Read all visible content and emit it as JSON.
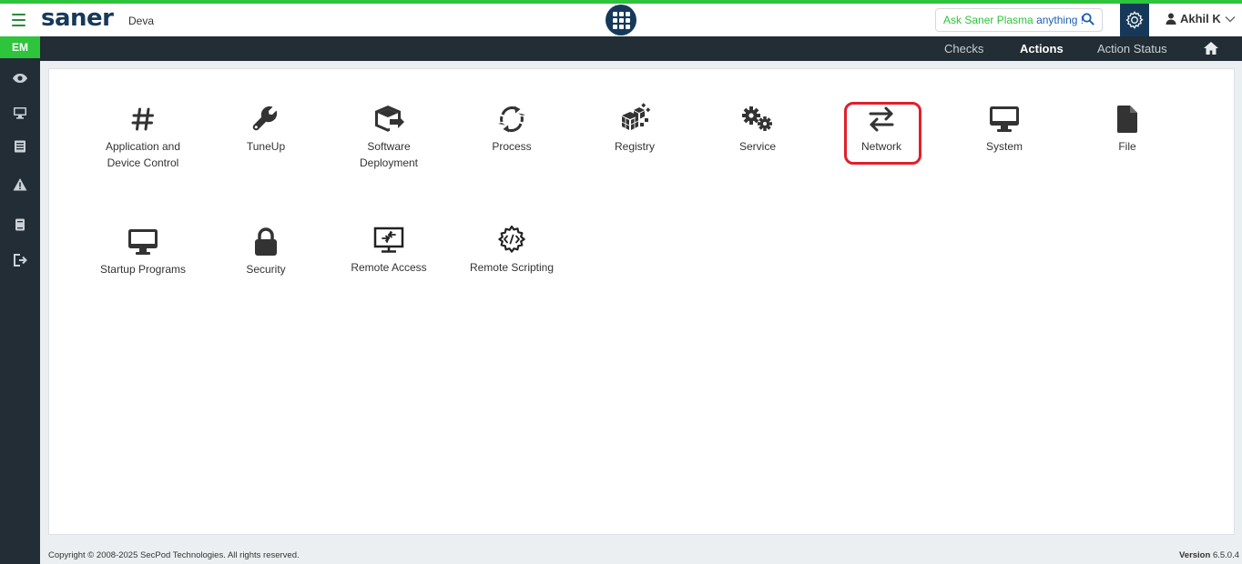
{
  "header": {
    "logo": "saner",
    "org_name": "Deva",
    "ask_prefix": "Ask Saner Plasma",
    "ask_suffix": "anything !",
    "user_name": "Akhil K",
    "brand_color": "#16395a",
    "accent_color": "#2ec43c"
  },
  "subnav": {
    "items": [
      {
        "label": "Checks",
        "active": false
      },
      {
        "label": "Actions",
        "active": true
      },
      {
        "label": "Action Status",
        "active": false
      }
    ]
  },
  "sidebar": {
    "badge": "EM",
    "icons": [
      "eye-icon",
      "monitor-icon",
      "list-icon",
      "alert-icon",
      "book-icon",
      "logout-icon"
    ]
  },
  "actions": {
    "row1": [
      {
        "label_lines": [
          "Application and",
          "Device Control"
        ],
        "icon": "hash-icon"
      },
      {
        "label_lines": [
          "TuneUp"
        ],
        "icon": "wrench-icon"
      },
      {
        "label_lines": [
          "Software",
          "Deployment"
        ],
        "icon": "software-deploy-icon"
      },
      {
        "label_lines": [
          "Process"
        ],
        "icon": "sync-icon"
      },
      {
        "label_lines": [
          "Registry"
        ],
        "icon": "registry-icon"
      },
      {
        "label_lines": [
          "Service"
        ],
        "icon": "gears-icon"
      },
      {
        "label_lines": [
          "Network"
        ],
        "icon": "exchange-icon"
      },
      {
        "label_lines": [
          "System"
        ],
        "icon": "desktop-icon"
      },
      {
        "label_lines": [
          "File"
        ],
        "icon": "file-icon"
      }
    ],
    "row2": [
      {
        "label_lines": [
          "Startup Programs"
        ],
        "icon": "desktop-icon"
      },
      {
        "label_lines": [
          "Security"
        ],
        "icon": "lock-icon"
      },
      {
        "label_lines": [
          "Remote Access"
        ],
        "icon": "remote-desktop-icon"
      },
      {
        "label_lines": [
          "Remote Scripting"
        ],
        "icon": "code-gear-icon"
      }
    ],
    "highlighted": "Network"
  },
  "footer": {
    "copyright": "Copyright © 2008-2025 SecPod Technologies. All rights reserved.",
    "version_label": "Version",
    "version_value": "6.5.0.4"
  }
}
